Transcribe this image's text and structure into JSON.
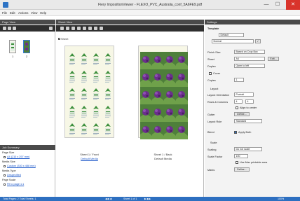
{
  "window": {
    "title": "Fiery ImpositionViewer - FLEXO_PVC_Australia_conf_5A6FE9.pdf",
    "minimize": "—",
    "maximize": "☐",
    "close": "✕"
  },
  "menu": [
    "File",
    "Edit",
    "Actions",
    "View",
    "Help"
  ],
  "left_panel": {
    "pages_header": "Page View",
    "thumb_labels": [
      "1",
      "2"
    ],
    "summary_header": "Job Summary",
    "summary_lines": [
      {
        "text": "Page Size",
        "kind": "heading"
      },
      {
        "text": "A4 (210 x 297 mm)",
        "kind": "link"
      },
      {
        "text": "Media Size",
        "kind": "heading"
      },
      {
        "text": "Custom (330 x 488 mm)",
        "kind": "link"
      },
      {
        "text": "Media Type",
        "kind": "heading"
      },
      {
        "text": "Unspecified",
        "kind": "link"
      },
      {
        "text": "Page Scale",
        "kind": "heading"
      },
      {
        "text": "Fit to page 1:1",
        "kind": "link"
      }
    ]
  },
  "canvas": {
    "header": "Sheet View",
    "sheet_label": "Sheet",
    "front_caption": "Sheet 1 / Front",
    "front_media": "Default Media",
    "back_caption": "Sheet 1 / Back",
    "back_media": "Default Media",
    "colors": {
      "front_bg": "#f7f7e6",
      "back_bg": "#f7f7e6",
      "leaf": "#3c8f3c",
      "flower": "#6b2f8c"
    }
  },
  "properties": {
    "header": "Settings",
    "tab": "Template",
    "template_value": "Default",
    "preset_value": "Normal",
    "fields": [
      {
        "label": "Finish Size",
        "value": "Based on Crop Box"
      },
      {
        "label": "Sheet",
        "value": "A4",
        "button": "Edit..."
      },
      {
        "label": "Duplex",
        "value": "Open to left"
      },
      {
        "label": "Cover",
        "value": ""
      },
      {
        "label": "Copies",
        "value": "1"
      }
    ],
    "layout_section": "Layout",
    "layout_fields": [
      {
        "label": "Layout Orientation",
        "value": "Portrait"
      },
      {
        "label": "Rows & Columns",
        "value": "4"
      },
      {
        "label": "Gutter",
        "value": "Define..."
      },
      {
        "label": "Layout Rule",
        "value": "Standard"
      }
    ],
    "align_to_center": "Align to center",
    "bleed_label": "Bleed",
    "bleed_value": "Apply Both",
    "scale_section": "Scale",
    "scale_fields": [
      {
        "label": "Scaling",
        "value": "Do not scale"
      },
      {
        "label": "Scale Factor",
        "value": "100"
      }
    ],
    "use_printable_area": "Use Max printable area",
    "marks_label": "Marks",
    "marks_button": "Define..."
  },
  "status": {
    "left": "Total Pages: 2   Total Sheets: 1",
    "center": "Sheet 1 of 1",
    "zoom": "100%"
  }
}
